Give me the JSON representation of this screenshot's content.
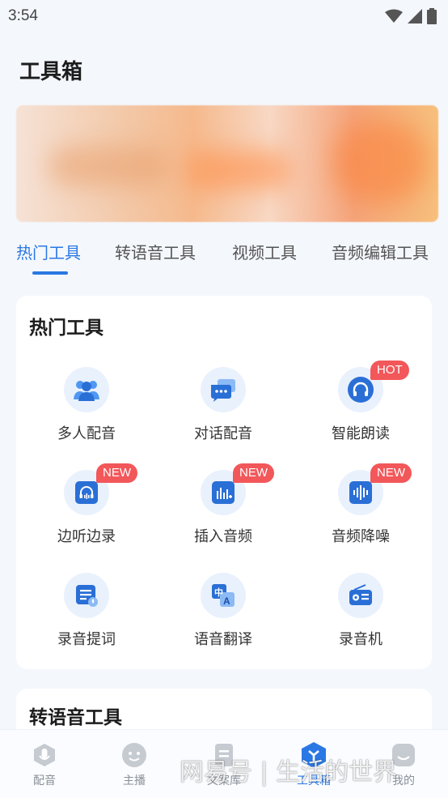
{
  "status": {
    "time": "3:54"
  },
  "page": {
    "title": "工具箱"
  },
  "tabs": [
    {
      "label": "热门工具",
      "active": true
    },
    {
      "label": "转语音工具",
      "active": false
    },
    {
      "label": "视频工具",
      "active": false
    },
    {
      "label": "音频编辑工具",
      "active": false
    }
  ],
  "hot_section": {
    "title": "热门工具",
    "tools": [
      {
        "label": "多人配音",
        "icon": "multi-person-icon",
        "badge": ""
      },
      {
        "label": "对话配音",
        "icon": "chat-bubble-icon",
        "badge": ""
      },
      {
        "label": "智能朗读",
        "icon": "headphones-icon",
        "badge": "HOT"
      },
      {
        "label": "边听边录",
        "icon": "headset-record-icon",
        "badge": "NEW"
      },
      {
        "label": "插入音频",
        "icon": "insert-audio-icon",
        "badge": "NEW"
      },
      {
        "label": "音频降噪",
        "icon": "waveform-icon",
        "badge": "NEW"
      },
      {
        "label": "录音提词",
        "icon": "teleprompter-icon",
        "badge": ""
      },
      {
        "label": "语音翻译",
        "icon": "translate-icon",
        "badge": ""
      },
      {
        "label": "录音机",
        "icon": "radio-recorder-icon",
        "badge": ""
      }
    ]
  },
  "tts_section": {
    "title": "转语音工具"
  },
  "bottom_nav": [
    {
      "label": "配音",
      "icon": "mic-icon",
      "active": false
    },
    {
      "label": "主播",
      "icon": "face-icon",
      "active": false
    },
    {
      "label": "文案库",
      "icon": "document-icon",
      "active": false
    },
    {
      "label": "工具箱",
      "icon": "toolbox-icon",
      "active": true
    },
    {
      "label": "我的",
      "icon": "profile-icon",
      "active": false
    }
  ],
  "watermark": "网易号 | 生活的世界",
  "colors": {
    "accent": "#2a78e4",
    "badge": "#f2575a",
    "icon_bg": "#e9f1fd"
  }
}
